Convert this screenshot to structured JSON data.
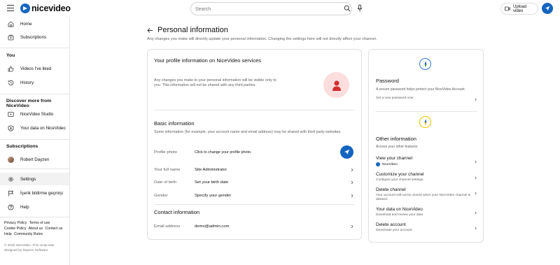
{
  "header": {
    "logo_text": "nicevideo",
    "search_placeholder": "Search",
    "upload_label": "Upload video"
  },
  "sidebar": {
    "main": [
      {
        "label": "Home",
        "icon": "home-icon"
      },
      {
        "label": "Subscriptions",
        "icon": "subscriptions-icon"
      }
    ],
    "you_title": "You",
    "you_items": [
      {
        "label": "Videos I've liked",
        "icon": "like-icon"
      },
      {
        "label": "History",
        "icon": "history-icon"
      }
    ],
    "discover_title": "Discover more from NiceVideo",
    "discover_items": [
      {
        "label": "NiceVideo Studio",
        "icon": "studio-icon"
      },
      {
        "label": "Your data on NiceVideo",
        "icon": "shield-icon"
      }
    ],
    "subscriptions_title": "Subscriptions",
    "subscription_items": [
      {
        "label": "Robert Dayzen",
        "icon": "channel-avatar"
      }
    ],
    "bottom_items": [
      {
        "label": "Settings",
        "icon": "gear-icon",
        "active": true
      },
      {
        "label": "İçerik bildirme geçmişi",
        "icon": "flag-icon"
      },
      {
        "label": "Help",
        "icon": "help-icon"
      }
    ],
    "footer_links": [
      "Privacy Policy",
      "Terms of use",
      "Cookie Policy",
      "About us",
      "Contact us",
      "Help",
      "Community Rules"
    ],
    "copyright": "© 2025 NiceVideo. This script was designed by Dayzen Software"
  },
  "main": {
    "title": "Personal information",
    "description": "Any changes you make will directly update your personal information. Changing the settings here will not directly affect your channel.",
    "profile_card": {
      "title": "Your profile information on NiceVideo services",
      "text": "Any changes you make to your personal information will be visible only to you. This information will not be shared with any third parties."
    },
    "basic": {
      "title": "Basic information",
      "desc": "Some information (for example, your account name and email address) may be shared with third party websites.",
      "rows": [
        {
          "label": "Profile photo",
          "value": "Click to change your profile photo."
        },
        {
          "label": "Your full name",
          "value": "Site Administrator"
        },
        {
          "label": "Date of birth",
          "value": "Set your birth date"
        },
        {
          "label": "Gender",
          "value": "Specify your gender"
        }
      ]
    },
    "contact": {
      "title": "Contact information",
      "rows": [
        {
          "label": "Email address",
          "value": "demo@admin.com"
        }
      ]
    }
  },
  "right": {
    "password": {
      "title": "Password",
      "desc": "A secure password helps protect your NiceVideo Account",
      "link": "Set a new password now"
    },
    "other": {
      "title": "Other information",
      "desc": "Access your other features",
      "items": [
        {
          "title": "View your channel",
          "sub": "NiceVideo"
        },
        {
          "title": "Customize your channel",
          "sub": "Configure your channel settings"
        },
        {
          "title": "Delete channel",
          "sub": "Your account will not be closed when your NiceVideo channel is deleted."
        },
        {
          "title": "Your data on NiceVideo",
          "sub": "Download and review your data"
        },
        {
          "title": "Delete account",
          "sub": "Deactivate your account"
        }
      ]
    }
  },
  "colors": {
    "brand": "#1565c0",
    "profile_icon": "#d32f2f",
    "profile_bg": "#fcdede",
    "ring_gold": "#f2c200",
    "ring_blue": "#2e7bd6"
  }
}
